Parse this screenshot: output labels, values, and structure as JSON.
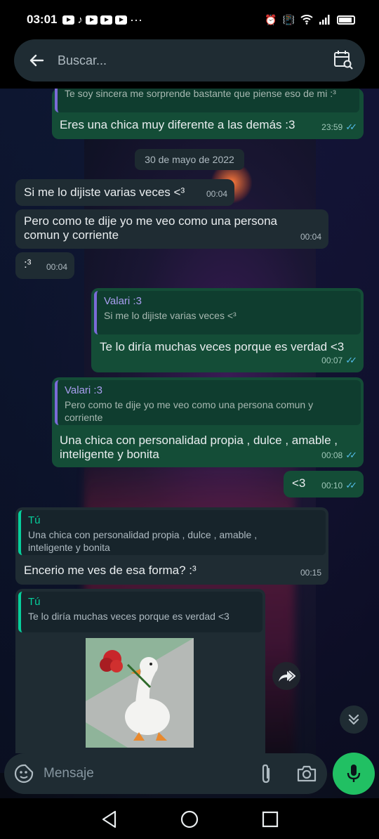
{
  "status_bar": {
    "time": "03:01",
    "more": "···"
  },
  "search": {
    "placeholder": "Buscar..."
  },
  "messages": {
    "m0": {
      "partial_quote": "Te soy sincera me sorprende bastante que piense eso de mi :³",
      "text": "Eres una chica muy diferente a las demás :3",
      "time": "23:59"
    },
    "date": "30 de mayo de 2022",
    "m1": {
      "text": "Si me lo dijiste varias veces <³",
      "time": "00:04"
    },
    "m2": {
      "text": "Pero como te dije yo me veo como una persona comun y corriente",
      "time": "00:04"
    },
    "m3": {
      "text": ":³",
      "time": "00:04"
    },
    "m4": {
      "quote_author": "Valari :3",
      "quote_text": "Si me lo dijiste varias veces <³",
      "text": "Te lo diría muchas veces porque es verdad <3",
      "time": "00:07"
    },
    "m5": {
      "quote_author": "Valari :3",
      "quote_text": "Pero como te dije yo me veo como una persona comun y corriente",
      "text": "Una chica con personalidad propia , dulce , amable , inteligente y bonita",
      "time": "00:08"
    },
    "m6": {
      "text": "<3",
      "time": "00:10"
    },
    "m7": {
      "quote_author": "Tú",
      "quote_text": "Una chica con personalidad propia , dulce , amable , inteligente y bonita",
      "text": "Encerio me ves de esa forma? :³",
      "time": "00:15"
    },
    "m8": {
      "quote_author": "Tú",
      "quote_text": "Te lo diría muchas veces porque es verdad <3",
      "sticker": "goose-with-rose-sticker"
    }
  },
  "composer": {
    "placeholder": "Mensaje"
  },
  "colors": {
    "incoming": "#1f2c33",
    "outgoing": "#144d37",
    "accent_green": "#21c063",
    "read_ticks": "#53bdeb"
  }
}
